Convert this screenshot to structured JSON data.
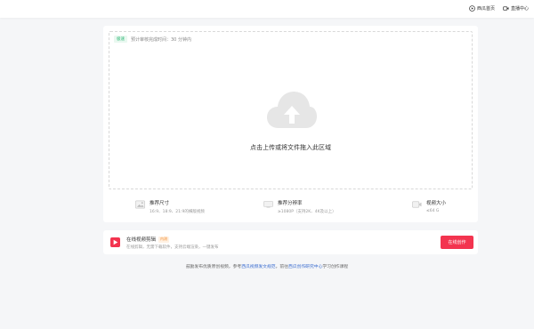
{
  "topbar": {
    "home_link": "西瓜首页",
    "live_link": "直播中心"
  },
  "upload": {
    "badge": "极速",
    "estimate_text": "预计审核完成时间：30 分钟内",
    "drop_label": "点击上传或将文件拖入此区域",
    "specs": [
      {
        "title": "推荐尺寸",
        "desc": "16:9、18:9、21:9的横版视频"
      },
      {
        "title": "推荐分辨率",
        "desc": "≥1080P（支持2K、4K及以上）"
      },
      {
        "title": "视频大小",
        "desc": "≤64 G"
      }
    ]
  },
  "editor": {
    "title": "在线视频剪辑",
    "badge": "内测",
    "desc": "在线剪辑，无需下载软件，支持云端渲染，一键发布",
    "button": "在线创作"
  },
  "footer": {
    "prefix": "鼓励发布优质原创视频，参考",
    "link1": "西瓜视频发文规范",
    "middle": "，前往",
    "link2": "西瓜创作研究中心",
    "suffix": "学习创作课程"
  },
  "colors": {
    "accent": "#f3344f",
    "link": "#3a6ccf",
    "success": "#2bb673",
    "beta": "#f28b2a"
  }
}
